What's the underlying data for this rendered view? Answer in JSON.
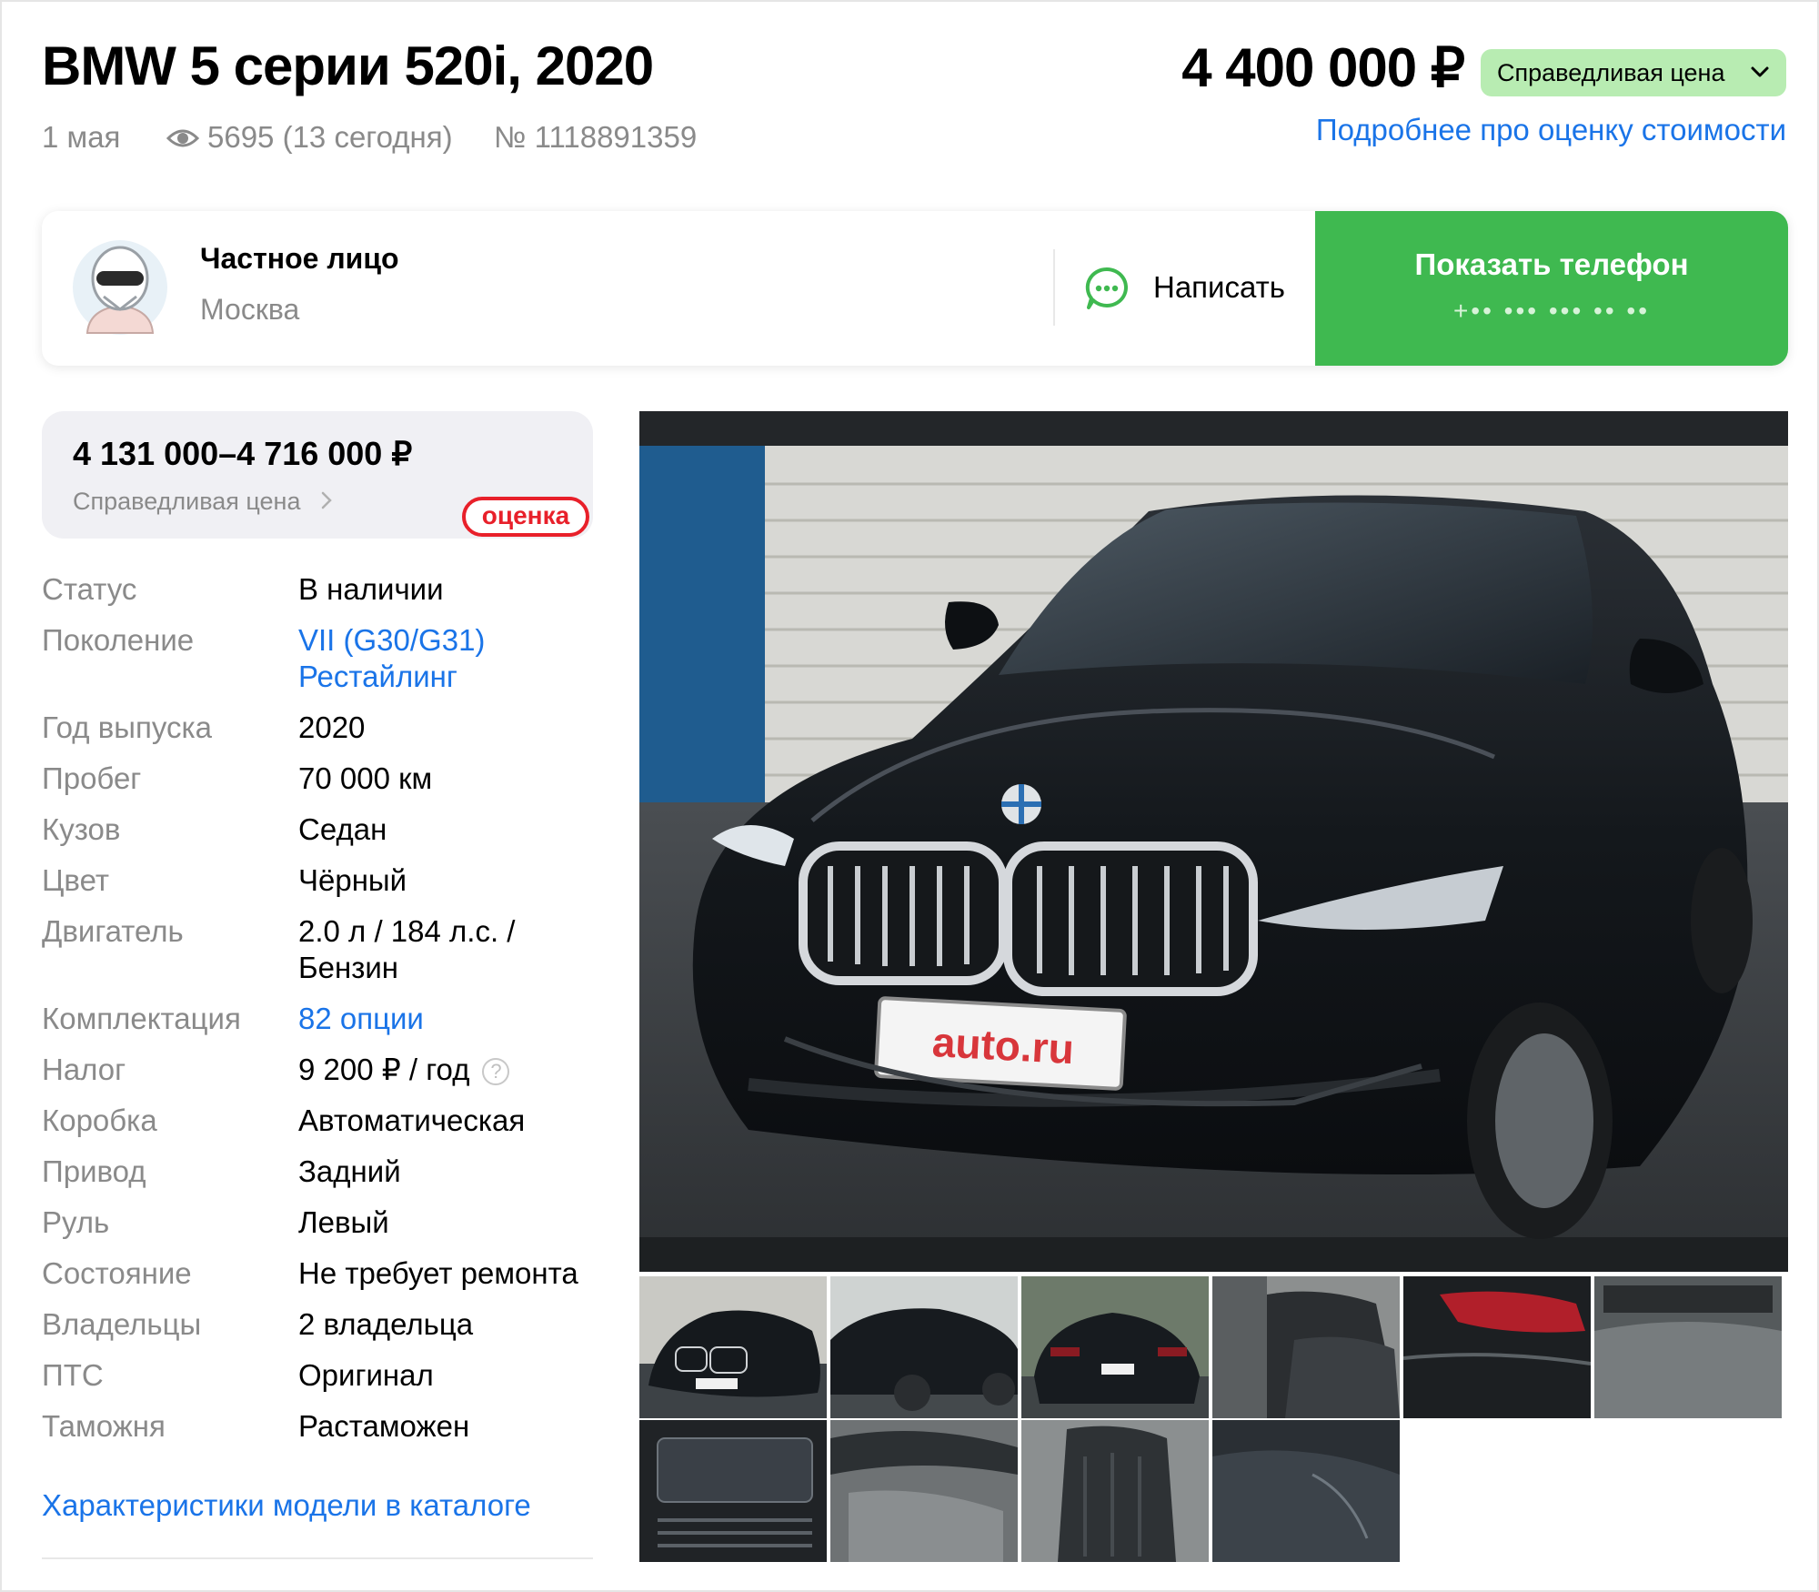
{
  "header": {
    "title": "BMW 5 серии 520i, 2020",
    "date": "1 мая",
    "views": "5695 (13 сегодня)",
    "listing_number": "№ 1118891359",
    "price": "4 400 000 ₽",
    "price_badge": "Справедливая цена",
    "price_link": "Подробнее про оценку стоимости"
  },
  "seller": {
    "type": "Частное лицо",
    "city": "Москва",
    "write_label": "Написать",
    "phone_button": "Показать телефон",
    "phone_mask": "+•• ••• ••• •• ••"
  },
  "estimate": {
    "range": "4 131 000–4 716 000 ₽",
    "label": "Справедливая цена",
    "badge": "оценка"
  },
  "specs": [
    {
      "label": "Статус",
      "value": "В наличии"
    },
    {
      "label": "Поколение",
      "value": "VII (G30/G31) Рестайлинг",
      "link": true
    },
    {
      "label": "Год выпуска",
      "value": "2020"
    },
    {
      "label": "Пробег",
      "value": "70 000 км"
    },
    {
      "label": "Кузов",
      "value": "Седан"
    },
    {
      "label": "Цвет",
      "value": "Чёрный"
    },
    {
      "label": "Двигатель",
      "value": "2.0 л / 184 л.с. / Бензин"
    },
    {
      "label": "Комплектация",
      "value": "82 опции",
      "link": true
    },
    {
      "label": "Налог",
      "value": "9 200 ₽ / год",
      "help": "?"
    },
    {
      "label": "Коробка",
      "value": "Автоматическая"
    },
    {
      "label": "Привод",
      "value": "Задний"
    },
    {
      "label": "Руль",
      "value": "Левый"
    },
    {
      "label": "Состояние",
      "value": "Не требует ремонта"
    },
    {
      "label": "Владельцы",
      "value": "2 владельца"
    },
    {
      "label": "ПТС",
      "value": "Оригинал"
    },
    {
      "label": "Таможня",
      "value": "Растаможен"
    }
  ],
  "catalog_link": "Характеристики модели в каталоге",
  "photo": {
    "plate_text": "auto.ru",
    "thumbnails": [
      "car-front",
      "car-side",
      "car-rear",
      "interior-seats",
      "tail-light",
      "floor",
      "dashboard-screen",
      "door-panel",
      "seat",
      "body-panel"
    ]
  },
  "colors": {
    "accent_green": "#3fb950",
    "badge_green": "#b8ecb2",
    "link_blue": "#1a74e8",
    "ocenka_red": "#e8202a"
  }
}
